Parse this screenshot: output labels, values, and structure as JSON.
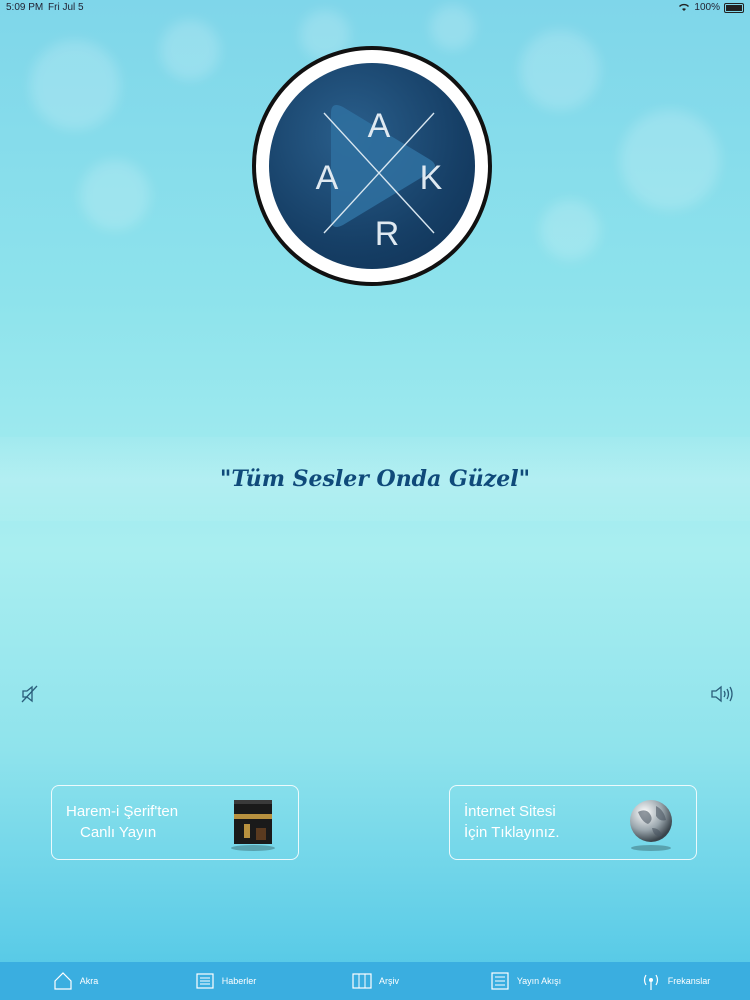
{
  "status_bar": {
    "time": "5:09 PM",
    "date": "Fri Jul 5",
    "battery": "100%"
  },
  "logo": {
    "letters": [
      "A",
      "K",
      "R",
      "A"
    ],
    "icon": "play-icon"
  },
  "slogan": "\"Tüm Sesler Onda Güzel\"",
  "volume": {
    "mute_icon": "speaker-mute-icon",
    "loud_icon": "speaker-loud-icon"
  },
  "cards": {
    "live": {
      "line1": "Harem-i Şerif'ten",
      "line2": "Canlı Yayın",
      "icon": "kaaba-icon"
    },
    "website": {
      "line1": "İnternet Sitesi",
      "line2": "İçin Tıklayınız.",
      "icon": "globe-icon"
    }
  },
  "tabs": [
    {
      "label": "Akra",
      "icon": "home-icon"
    },
    {
      "label": "Haberler",
      "icon": "news-icon"
    },
    {
      "label": "Arşiv",
      "icon": "archive-icon"
    },
    {
      "label": "Yayın Akışı",
      "icon": "list-icon"
    },
    {
      "label": "Frekanslar",
      "icon": "broadcast-icon"
    }
  ],
  "colors": {
    "tab_bar": "#3aaee0",
    "slogan": "#0f4a7a",
    "logo_bg": "#163f66"
  }
}
